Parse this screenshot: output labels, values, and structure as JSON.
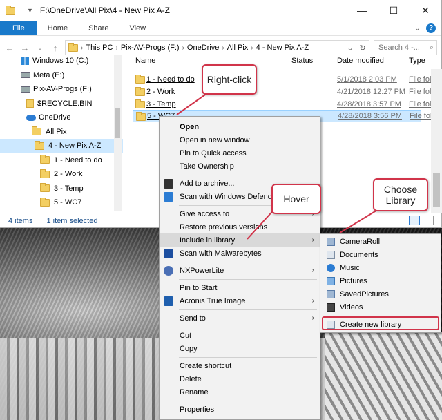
{
  "window": {
    "title": "F:\\OneDrive\\All Pix\\4 - New Pix A-Z",
    "controls": [
      "—",
      "☐",
      "✕"
    ]
  },
  "ribbon": {
    "tabs": [
      "File",
      "Home",
      "Share",
      "View"
    ]
  },
  "address": {
    "crumbs": [
      "This PC",
      "Pix-AV-Progs (F:)",
      "OneDrive",
      "All Pix",
      "4 - New Pix A-Z"
    ],
    "search_placeholder": "Search 4 -..."
  },
  "nav": {
    "items": [
      {
        "label": "Windows 10 (C:)",
        "icon": "windows-drive-icon"
      },
      {
        "label": "Meta (E:)",
        "icon": "drive-icon"
      },
      {
        "label": "Pix-AV-Progs (F:)",
        "icon": "drive-icon"
      },
      {
        "label": "$RECYCLE.BIN",
        "icon": "recycle-bin-icon"
      },
      {
        "label": "OneDrive",
        "icon": "onedrive-icon"
      },
      {
        "label": "All Pix",
        "icon": "folder-icon"
      },
      {
        "label": "4 - New Pix A-Z",
        "icon": "folder-icon",
        "selected": true
      },
      {
        "label": "1 - Need to do",
        "icon": "folder-icon"
      },
      {
        "label": "2 - Work",
        "icon": "folder-icon"
      },
      {
        "label": "3 - Temp",
        "icon": "folder-icon"
      },
      {
        "label": "5 - WC7",
        "icon": "folder-icon"
      }
    ]
  },
  "columns": [
    "Name",
    "Status",
    "Date modified",
    "Type"
  ],
  "files": [
    {
      "name": "1 - Need to do",
      "date": "5/1/2018 2:03 PM",
      "type": "File folder"
    },
    {
      "name": "2 - Work",
      "date": "4/21/2018 12:27 PM",
      "type": "File folder"
    },
    {
      "name": "3 - Temp",
      "date": "4/28/2018 3:57 PM",
      "type": "File folder"
    },
    {
      "name": "5 - WC7",
      "date": "4/28/2018 3:56 PM",
      "type": "File folder",
      "selected": true
    }
  ],
  "status": {
    "items": "4 items",
    "selected": "1 item selected"
  },
  "context_menu": {
    "items": [
      {
        "label": "Open",
        "bold": true
      },
      {
        "label": "Open in new window"
      },
      {
        "label": "Pin to Quick access"
      },
      {
        "label": "Take Ownership"
      },
      {
        "label": "Add to archive...",
        "icon": "winrar-icon"
      },
      {
        "label": "Scan with Windows Defender...",
        "icon": "defender-icon"
      },
      {
        "label": "Give access to",
        "submenu": true
      },
      {
        "label": "Restore previous versions"
      },
      {
        "label": "Include in library",
        "submenu": true,
        "hover": true
      },
      {
        "label": "Scan with Malwarebytes",
        "icon": "malwarebytes-icon"
      },
      {
        "label": "NXPowerLite",
        "icon": "nxpowerlite-icon",
        "submenu": true
      },
      {
        "label": "Pin to Start"
      },
      {
        "label": "Acronis True Image",
        "icon": "acronis-icon",
        "submenu": true
      },
      {
        "label": "Send to",
        "submenu": true
      },
      {
        "label": "Cut"
      },
      {
        "label": "Copy"
      },
      {
        "label": "Create shortcut"
      },
      {
        "label": "Delete"
      },
      {
        "label": "Rename"
      },
      {
        "label": "Properties"
      }
    ]
  },
  "submenu": {
    "items": [
      {
        "label": "CameraRoll",
        "icon": "library-icon"
      },
      {
        "label": "Documents",
        "icon": "documents-library-icon"
      },
      {
        "label": "Music",
        "icon": "music-library-icon"
      },
      {
        "label": "Pictures",
        "icon": "pictures-library-icon"
      },
      {
        "label": "SavedPictures",
        "icon": "library-icon"
      },
      {
        "label": "Videos",
        "icon": "videos-library-icon"
      },
      {
        "label": "Create new library",
        "icon": "new-library-icon"
      }
    ]
  },
  "callouts": {
    "right_click": "Right-click",
    "hover": "Hover",
    "choose_library_1": "Choose",
    "choose_library_2": "Library"
  },
  "colors": {
    "accent": "#1979ca",
    "callout_border": "#d1344a",
    "selection": "#cce8ff"
  }
}
